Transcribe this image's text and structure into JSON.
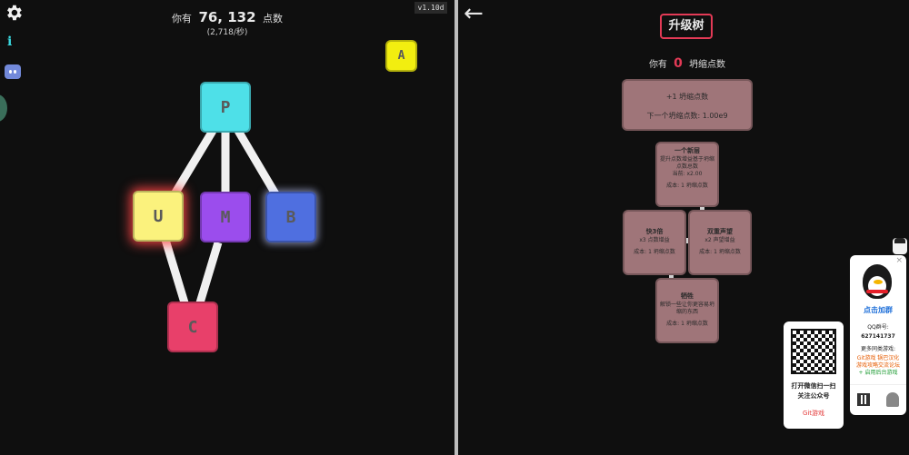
{
  "left": {
    "points_prefix": "你有",
    "points_value": "76, 132",
    "points_suffix": "点数",
    "rate": "(2,718/秒)",
    "version": "v1.10d",
    "icons": {
      "settings": "gear-icon",
      "info": "i",
      "discord": "discord-icon"
    },
    "nodes": {
      "a": "A",
      "p": "P",
      "u": "U",
      "m": "M",
      "b": "B",
      "c": "C"
    }
  },
  "right": {
    "back": "←",
    "title": "升级树",
    "pts_prefix": "你有",
    "pts_value": "0",
    "pts_suffix": "坍缩点数",
    "prestige": {
      "line1": "+1 坍缩点数",
      "line2": "下一个坍缩点数: 1.00e9"
    },
    "upgrades": [
      {
        "title": "一个新层",
        "desc": "提升点数增益基于坍缩点数总数",
        "extra": "当前: x2.00",
        "cost": "成本: 1 坍缩点数"
      },
      {
        "title": "快3倍",
        "desc": "x3 点数增益",
        "extra": "",
        "cost": "成本: 1 坍缩点数"
      },
      {
        "title": "双重声望",
        "desc": "x2 声望增益",
        "extra": "",
        "cost": "成本: 1 坍缩点数"
      },
      {
        "title": "牺牲",
        "desc": "解锁一些让你更容易坍缩的东西",
        "extra": "",
        "cost": "成本: 1 坍缩点数"
      }
    ]
  },
  "qq": {
    "close": "×",
    "join": "点击加群",
    "group_label": "QQ群号:",
    "group_number": "627141737",
    "more": "更多同类游戏:",
    "link1": "Git游戏 锅巴汉化",
    "link2": "游戏攻略交流论坛",
    "link3": "+ 启用后台游戏"
  },
  "wechat": {
    "line1": "打开微信扫一扫",
    "line2": "关注公众号",
    "line3": "Git游戏"
  },
  "colors": {
    "accent": "#e33a56",
    "upgrade_bg": "#9f7579",
    "node_p": "#4ee0e8",
    "node_u": "#fbf27d",
    "node_m": "#9b4ded",
    "node_b": "#4f6fe0",
    "node_c": "#e8406a",
    "node_a": "#f2ee10"
  }
}
